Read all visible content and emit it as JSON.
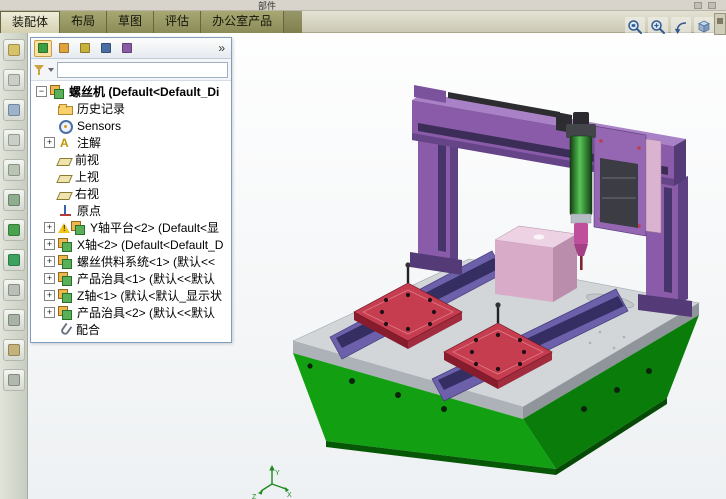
{
  "top_toolbar": {
    "partial_label": "部件"
  },
  "command_tabs": {
    "items": [
      {
        "label": "装配体",
        "active": true
      },
      {
        "label": "布局",
        "active": false
      },
      {
        "label": "草图",
        "active": false
      },
      {
        "label": "评估",
        "active": false
      },
      {
        "label": "办公室产品",
        "active": false
      }
    ]
  },
  "view_toolbar": {
    "icons": [
      {
        "name": "zoom-fit-icon"
      },
      {
        "name": "zoom-area-icon"
      },
      {
        "name": "previous-view-icon"
      },
      {
        "name": "view-orientation-icon"
      }
    ]
  },
  "left_toolbar": {
    "icons": [
      {
        "name": "toolbar-icon-1",
        "color": "#d7c26a"
      },
      {
        "name": "toolbar-icon-2",
        "color": "#c9cfc6"
      },
      {
        "name": "toolbar-icon-3",
        "color": "#9db3cc"
      },
      {
        "name": "toolbar-icon-4",
        "color": "#c9cfc6"
      },
      {
        "name": "toolbar-icon-5",
        "color": "#b9c4b2"
      },
      {
        "name": "toolbar-icon-6",
        "color": "#8fae8f"
      },
      {
        "name": "toolbar-icon-7",
        "color": "#49a34e"
      },
      {
        "name": "toolbar-icon-8",
        "color": "#3da25f"
      },
      {
        "name": "toolbar-icon-9",
        "color": "#b9bfb6"
      },
      {
        "name": "toolbar-icon-10",
        "color": "#a8b2a5"
      },
      {
        "name": "toolbar-icon-11",
        "color": "#c4b27a"
      },
      {
        "name": "toolbar-icon-12",
        "color": "#b0b8ae"
      }
    ]
  },
  "feature_panel": {
    "collapse_label": "»",
    "header_icons": [
      {
        "name": "featuremanager-tree-icon",
        "color": "#3f9e3f"
      },
      {
        "name": "propertymanager-icon",
        "color": "#e0a23c"
      },
      {
        "name": "configurationmanager-icon",
        "color": "#c8b03c"
      },
      {
        "name": "dimxpert-icon",
        "color": "#4a6fa5"
      },
      {
        "name": "displaymanager-icon",
        "color": "#8a5ca6"
      }
    ],
    "filter_value": "",
    "tree": [
      {
        "label": "螺丝机 (Default<Default_Di",
        "icon": "assembly",
        "bold": true,
        "level": 0,
        "expander": "minus"
      },
      {
        "label": "历史记录",
        "icon": "history-folder",
        "level": 1
      },
      {
        "label": "Sensors",
        "icon": "sensors",
        "level": 1
      },
      {
        "label": "注解",
        "icon": "annotations",
        "level": 1,
        "expander": "plus"
      },
      {
        "label": "前视",
        "icon": "plane",
        "level": 1
      },
      {
        "label": "上视",
        "icon": "plane",
        "level": 1
      },
      {
        "label": "右视",
        "icon": "plane",
        "level": 1
      },
      {
        "label": "原点",
        "icon": "origin",
        "level": 1
      },
      {
        "label": "Y轴平台<2> (Default<显",
        "icon": "assembly",
        "level": 1,
        "expander": "plus",
        "warning": true
      },
      {
        "label": "X轴<2> (Default<Default_D",
        "icon": "assembly",
        "level": 1,
        "expander": "plus"
      },
      {
        "label": "螺丝供料系统<1> (默认<<",
        "icon": "assembly",
        "level": 1,
        "expander": "plus"
      },
      {
        "label": "产品治具<1> (默认<<默认",
        "icon": "assembly",
        "level": 1,
        "expander": "plus"
      },
      {
        "label": "Z轴<1> (默认<默认_显示状",
        "icon": "assembly",
        "level": 1,
        "expander": "plus"
      },
      {
        "label": "产品治具<2> (默认<<默认",
        "icon": "assembly",
        "level": 1,
        "expander": "plus"
      },
      {
        "label": "配合",
        "icon": "mates",
        "level": 1
      }
    ]
  },
  "viewport": {
    "triad": {
      "x_label": "X",
      "y_label": "Y",
      "z_label": "Z"
    }
  },
  "model_colors": {
    "base_green": "#12a012",
    "table_gray": "#d2d6d9",
    "rail_purple": "#6c60ab",
    "fixture_plate_red": "#c73d50",
    "gantry_purple": "#8a5ba9",
    "spindle_green": "#46b046",
    "product_box_pink": "#d8abc9",
    "collet_magenta": "#bf4f9d"
  }
}
